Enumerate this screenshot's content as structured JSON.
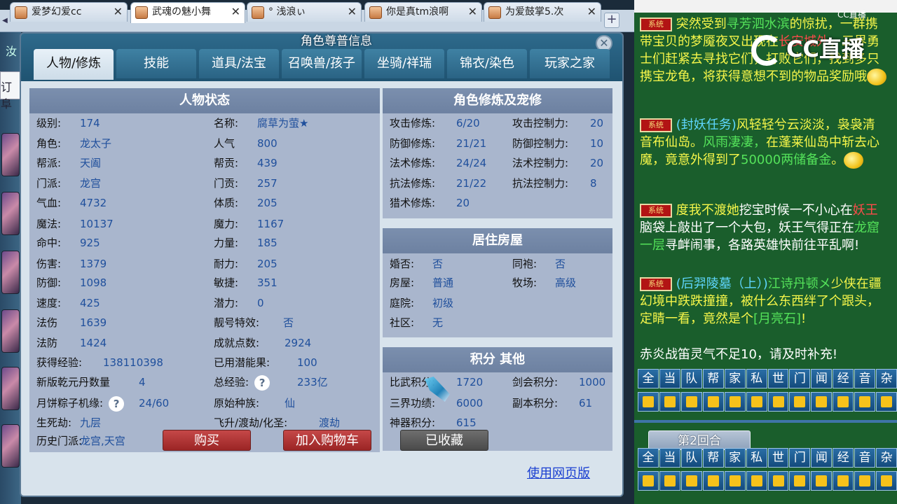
{
  "browser": {
    "tabs": [
      {
        "title": "爱梦幻爱cc",
        "active": false
      },
      {
        "title": "武魂の魅小舞",
        "active": true
      },
      {
        "title": "° 浅浪ぃ",
        "active": false
      },
      {
        "title": "你是真tm浪啊",
        "active": false
      },
      {
        "title": "为爱鼓掌5.次",
        "active": false
      }
    ],
    "new_tab_label": "+",
    "close_label": "✕"
  },
  "left_strip": {
    "text1": "汝",
    "text2": "订阜"
  },
  "dialog": {
    "title": "角色尊普信息",
    "close_label": "✕",
    "tabs": [
      "人物/修炼",
      "技能",
      "道具/法宝",
      "召唤兽/孩子",
      "坐骑/祥瑞",
      "锦衣/染色",
      "玩家之家"
    ]
  },
  "status": {
    "header": "人物状态",
    "left": [
      {
        "label": "级别:",
        "value": "174"
      },
      {
        "label": "角色:",
        "value": "龙太子"
      },
      {
        "label": "帮派:",
        "value": "天阖"
      },
      {
        "label": "门派:",
        "value": "龙宫"
      },
      {
        "label": "气血:",
        "value": "4732"
      },
      {
        "label": "魔法:",
        "value": "10137"
      },
      {
        "label": "命中:",
        "value": "925"
      },
      {
        "label": "伤害:",
        "value": "1379"
      },
      {
        "label": "防御:",
        "value": "1098"
      },
      {
        "label": "速度:",
        "value": "425"
      },
      {
        "label": "法伤",
        "value": "1639"
      },
      {
        "label": "法防",
        "value": "1424"
      },
      {
        "label": "获得经验:",
        "value": "138110398"
      },
      {
        "label": "新版乾元丹数量",
        "value": "4"
      },
      {
        "label": "月饼粽子机缘:",
        "value": "24/60"
      },
      {
        "label": "生死劫:",
        "value": "九层"
      },
      {
        "label": "历史门派:",
        "value": "龙宫,天宫"
      }
    ],
    "right": [
      {
        "label": "名称:",
        "value": "腐草为萤★"
      },
      {
        "label": "人气",
        "value": "800"
      },
      {
        "label": "帮贡:",
        "value": "439"
      },
      {
        "label": "门贡:",
        "value": "257"
      },
      {
        "label": "体质:",
        "value": "205"
      },
      {
        "label": "魔力:",
        "value": "1167"
      },
      {
        "label": "力量:",
        "value": "185"
      },
      {
        "label": "耐力:",
        "value": "205"
      },
      {
        "label": "敏捷:",
        "value": "351"
      },
      {
        "label": "潜力:",
        "value": "0"
      },
      {
        "label": "靓号特效:",
        "value": "否"
      },
      {
        "label": "成就点数:",
        "value": "2924"
      },
      {
        "label": "已用潜能果:",
        "value": "100"
      },
      {
        "label": "总经验:",
        "value": "233亿"
      },
      {
        "label": "原始种族:",
        "value": "仙"
      },
      {
        "label": "飞升/渡劫/化圣:",
        "value": "渡劫"
      }
    ],
    "help_icon": "?"
  },
  "cultivation": {
    "header": "角色修炼及宠修",
    "rows": [
      {
        "l1": "攻击修炼:",
        "v1": "6/20",
        "l2": "攻击控制力:",
        "v2": "20"
      },
      {
        "l1": "防御修炼:",
        "v1": "21/21",
        "l2": "防御控制力:",
        "v2": "10"
      },
      {
        "l1": "法术修炼:",
        "v1": "24/24",
        "l2": "法术控制力:",
        "v2": "20"
      },
      {
        "l1": "抗法修炼:",
        "v1": "21/22",
        "l2": "抗法控制力:",
        "v2": "8"
      }
    ],
    "hunt": {
      "label": "猎术修炼:",
      "value": "20"
    }
  },
  "housing": {
    "header": "居住房屋",
    "rows": [
      {
        "l1": "婚否:",
        "v1": "否",
        "l2": "同袍:",
        "v2": "否"
      },
      {
        "l1": "房屋:",
        "v1": "普通",
        "l2": "牧场:",
        "v2": "高级"
      }
    ],
    "yard": {
      "label": "庭院:",
      "value": "初级"
    },
    "community": {
      "label": "社区:",
      "value": "无"
    }
  },
  "points": {
    "header": "积分 其他",
    "rows": [
      {
        "l1": "比武积分:",
        "v1": "1720",
        "l2": "剑会积分:",
        "v2": "1000"
      },
      {
        "l1": "三界功绩:",
        "v1": "6000",
        "l2": "副本积分:",
        "v2": "61"
      }
    ],
    "artifact": {
      "label": "神器积分:",
      "value": "615"
    }
  },
  "actions": {
    "buy": "购买",
    "add_cart": "加入购物车",
    "collected": "已收藏",
    "web": "使用网页版"
  },
  "chat": {
    "badge": "系统",
    "logo": "CC直播",
    "logo_small": "CC直播",
    "m1": {
      "a": "突然受到",
      "b": "寻芳泗水滨",
      "c": "的惊扰，一群携带宝贝的梦魇夜叉出现在",
      "d": "长安城外",
      "e": "，三界勇士们赶紧去寻找它们，打败它们，找到多只携宝龙龟，将获得意想不到的物品奖励哦"
    },
    "m2": {
      "a": "(封妖任务)",
      "b": "风轻轻兮云淡淡，袅袅清音布仙岛。",
      "c": "风雨凄凄，",
      "d": "在蓬莱仙岛中斩去心魔，竟意外得到了",
      "e": "50000两储备金",
      "f": "。"
    },
    "m3": {
      "a": "度我不渡她",
      "b": "挖宝时候一不小心在",
      "c": "妖王",
      "d": "脑袋上敲出了一个大包，妖王气得正在",
      "e": "龙窟一层",
      "f": "寻衅闹事，各路英雄快前往平乱啊!"
    },
    "m4": {
      "a": "(后羿陵墓（上）)",
      "b": "江诗丹顿メ",
      "c": "少侠在",
      "d": "疆幻境中跌跌撞撞，被什么东西绊了个跟头，定睛一看，竟然是个",
      "e": "[月亮石]",
      "f": "!"
    },
    "m5": "赤炎战笛灵气不足10，请及时补充!",
    "channels": [
      "全",
      "当",
      "队",
      "帮",
      "家",
      "私",
      "世",
      "门",
      "闻",
      "经",
      "音",
      "杂"
    ],
    "round": "第2回合"
  }
}
